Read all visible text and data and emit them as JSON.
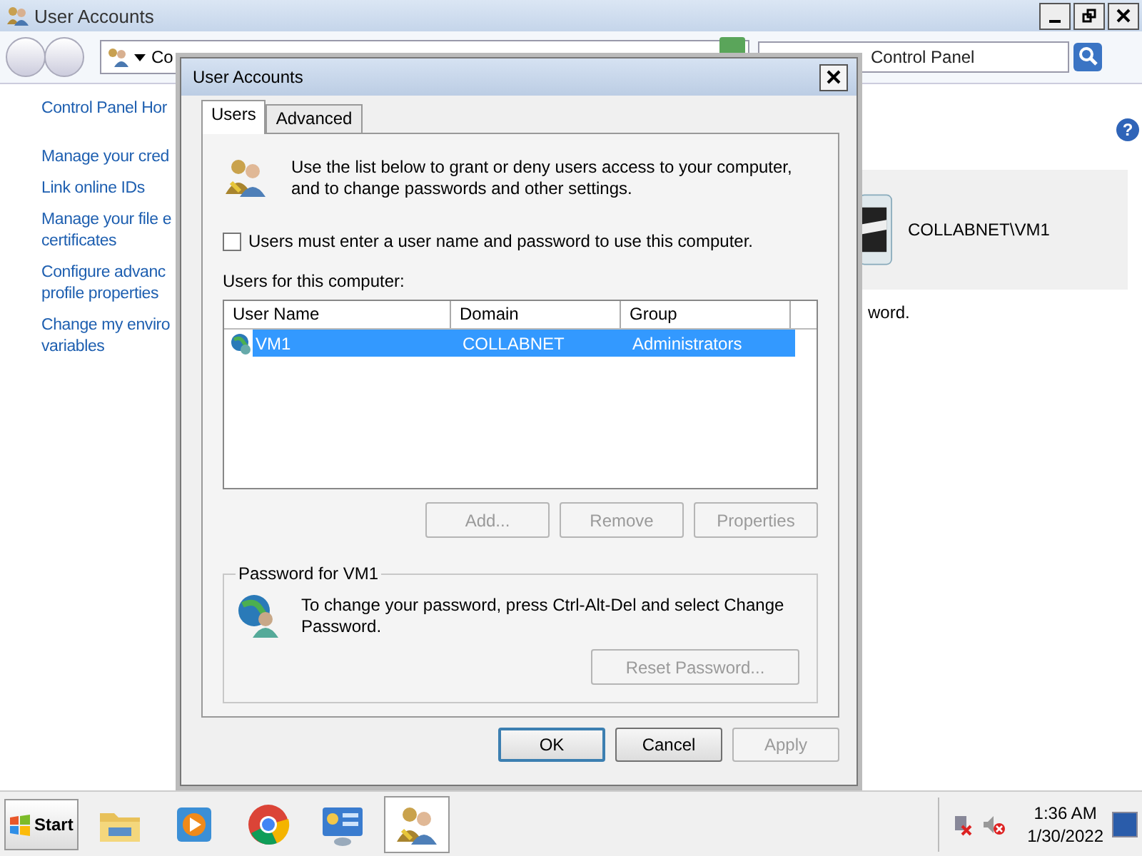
{
  "window": {
    "title": "User Accounts"
  },
  "address": {
    "text": "Co"
  },
  "search": {
    "placeholder": "Control Panel"
  },
  "help": {
    "glyph": "?"
  },
  "sidebar": {
    "items": [
      {
        "label": "Control Panel Hor",
        "kind": "home"
      },
      {
        "label": "Manage your cred",
        "kind": "link"
      },
      {
        "label": "Link online IDs",
        "kind": "link"
      },
      {
        "label": "Manage your file e\ncertificates",
        "kind": "link"
      },
      {
        "label": "Configure advanc\nprofile properties",
        "kind": "link"
      },
      {
        "label": "Change my enviro\nvariables",
        "kind": "link"
      }
    ]
  },
  "account": {
    "name": "COLLABNET\\VM1",
    "note": "word."
  },
  "dialog": {
    "title": "User Accounts",
    "tabs": [
      {
        "label": "Users",
        "selected": true
      },
      {
        "label": "Advanced",
        "selected": false
      }
    ],
    "intro": "Use the list below to grant or deny users access to your computer, and to change passwords and other settings.",
    "require_password": {
      "label": "Users must enter a user name and password to use this computer.",
      "checked": false
    },
    "users_label": "Users for this computer:",
    "columns": [
      "User Name",
      "Domain",
      "Group"
    ],
    "rows": [
      {
        "user": "VM1",
        "domain": "COLLABNET",
        "group": "Administrators",
        "selected": true
      }
    ],
    "list_buttons": [
      {
        "label": "Add...",
        "disabled": true
      },
      {
        "label": "Remove",
        "disabled": true
      },
      {
        "label": "Properties",
        "disabled": true
      }
    ],
    "password_group": {
      "legend": "Password for VM1",
      "text": "To change your password, press Ctrl-Alt-Del and select Change Password.",
      "button": {
        "label": "Reset Password...",
        "disabled": true
      }
    },
    "buttons": [
      {
        "label": "OK",
        "disabled": false
      },
      {
        "label": "Cancel",
        "disabled": false
      },
      {
        "label": "Apply",
        "disabled": true
      }
    ]
  },
  "taskbar": {
    "start": "Start",
    "apps": [
      {
        "kind": "folder",
        "selected": false
      },
      {
        "kind": "media",
        "selected": false
      },
      {
        "kind": "browser",
        "selected": false
      },
      {
        "kind": "panel",
        "selected": false
      },
      {
        "kind": "users",
        "selected": true
      }
    ],
    "time": "1:36 AM",
    "date": "1/30/2022"
  }
}
